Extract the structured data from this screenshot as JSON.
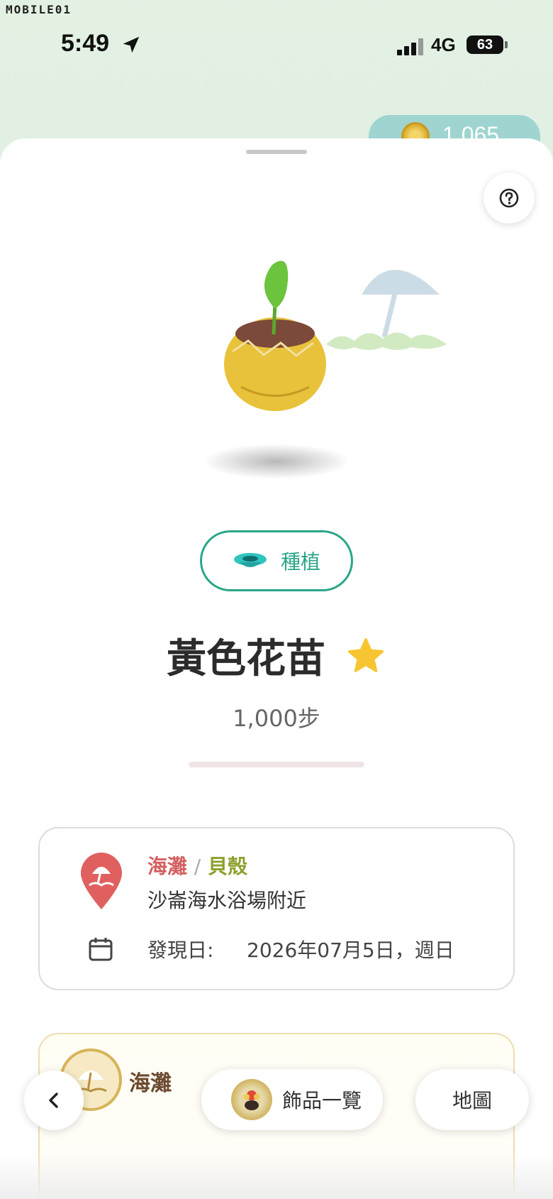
{
  "watermark": "MOBILE01",
  "status": {
    "time": "5:49",
    "network": "4G",
    "battery": "63"
  },
  "coins": {
    "count": "1,065"
  },
  "item": {
    "category_label": "種植",
    "title": "黃色花苗",
    "steps": "1,000步"
  },
  "location": {
    "area": "海灘",
    "separator": "/",
    "category": "貝殼",
    "place": "沙崙海水浴場附近",
    "found_label": "發現日:",
    "found_date": "2026年07月5日，週日"
  },
  "area_card": {
    "name": "海灘"
  },
  "nav": {
    "collection_label": "飾品一覽",
    "map_label": "地圖"
  },
  "colors": {
    "accent_teal": "#2aa68a",
    "area_red": "#d46060",
    "category_green": "#8ca02c",
    "star_yellow": "#f6c531"
  },
  "icons": {
    "help": "question-icon",
    "back": "chevron-left-icon",
    "location": "beach-pin-icon",
    "calendar": "calendar-icon",
    "category": "pot-icon",
    "favorite": "star-icon"
  }
}
